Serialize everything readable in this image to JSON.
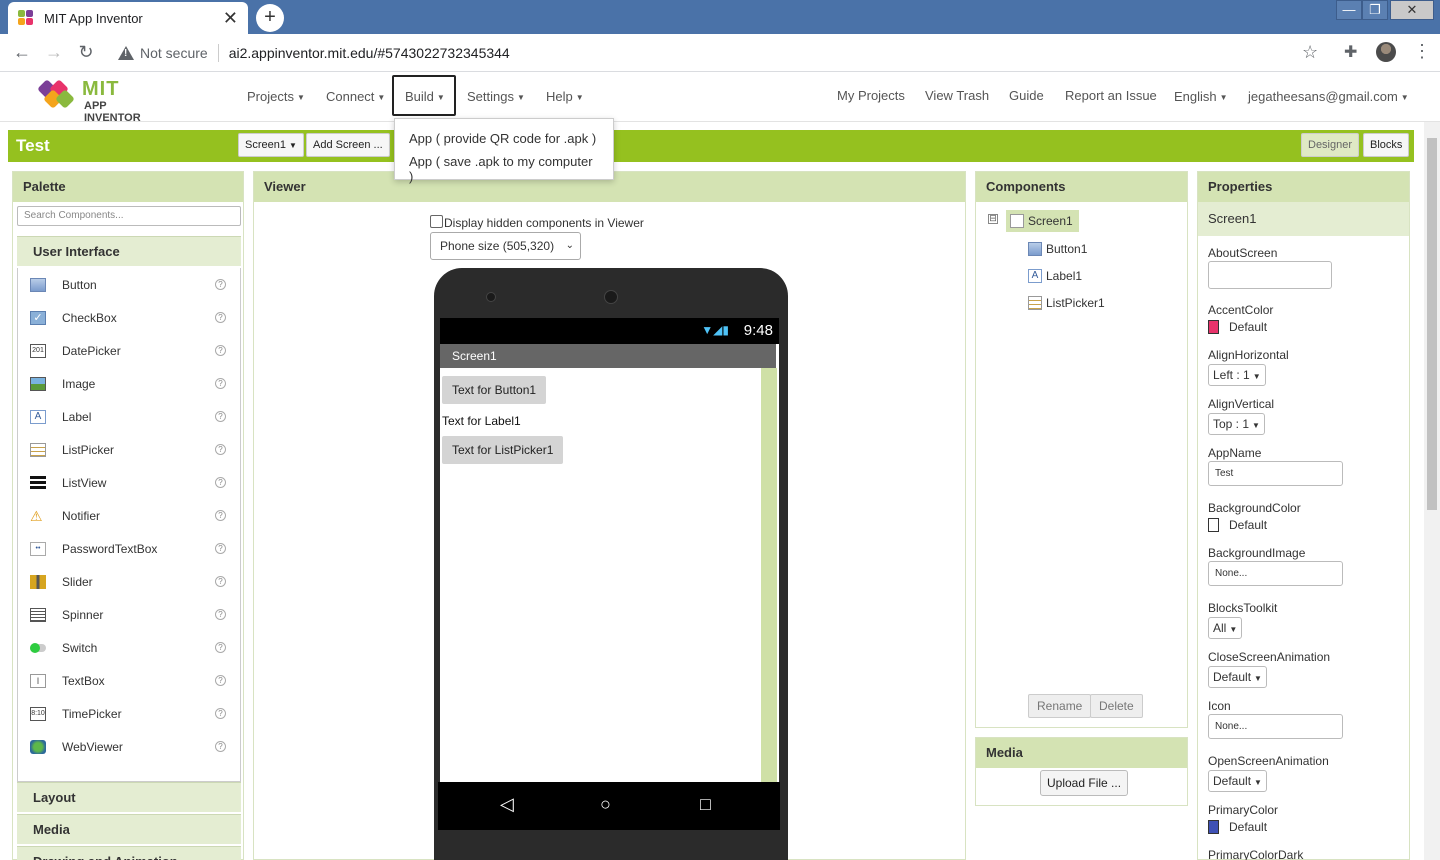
{
  "browser": {
    "tab_title": "MIT App Inventor",
    "tab_close": "✕",
    "new_tab": "+",
    "not_secure": "Not secure",
    "url": "ai2.appinventor.mit.edu/#5743022732345344",
    "window_controls": [
      "—",
      "❐",
      "✕"
    ]
  },
  "header": {
    "logo_mit": "MIT",
    "logo_sub": "APP INVENTOR",
    "left_menu": [
      "Projects",
      "Connect",
      "Build",
      "Settings",
      "Help"
    ],
    "right_links": [
      "My Projects",
      "View Trash",
      "Guide",
      "Report an Issue"
    ],
    "language": "English",
    "account": "jegatheesans@gmail.com"
  },
  "build_menu": {
    "items": [
      "App ( provide QR code for .apk )",
      "App ( save .apk to my computer )"
    ]
  },
  "project": {
    "title": "Test",
    "screen_select": "Screen1",
    "add_screen": "Add Screen ...",
    "designer": "Designer",
    "blocks": "Blocks"
  },
  "palette": {
    "title": "Palette",
    "search_placeholder": "Search Components...",
    "category_open": "User Interface",
    "items": [
      "Button",
      "CheckBox",
      "DatePicker",
      "Image",
      "Label",
      "ListPicker",
      "ListView",
      "Notifier",
      "PasswordTextBox",
      "Slider",
      "Spinner",
      "Switch",
      "TextBox",
      "TimePicker",
      "WebViewer"
    ],
    "help_glyph": "?",
    "categories_closed": [
      "Layout",
      "Media",
      "Drawing and Animation"
    ]
  },
  "viewer": {
    "title": "Viewer",
    "hidden_label": "Display hidden components in Viewer",
    "size_select": "Phone size (505,320)",
    "phone": {
      "time": "9:48",
      "signal": "▼◢▮",
      "screen_title": "Screen1",
      "button_text": "Text for Button1",
      "label_text": "Text for Label1",
      "listpicker_text": "Text for ListPicker1",
      "nav": [
        "◁",
        "○",
        "□"
      ]
    }
  },
  "components": {
    "title": "Components",
    "toggle": "⊟",
    "tree": [
      "Screen1",
      "Button1",
      "Label1",
      "ListPicker1"
    ],
    "rename": "Rename",
    "delete": "Delete"
  },
  "media": {
    "title": "Media",
    "upload": "Upload File ..."
  },
  "properties": {
    "title": "Properties",
    "subject": "Screen1",
    "about_screen_label": "AboutScreen",
    "accent_label": "AccentColor",
    "accent_value": "Default",
    "accent_color": "#e8336b",
    "align_h_label": "AlignHorizontal",
    "align_h_value": "Left : 1",
    "align_v_label": "AlignVertical",
    "align_v_value": "Top : 1",
    "appname_label": "AppName",
    "appname_value": "Test",
    "bgcolor_label": "BackgroundColor",
    "bgcolor_value": "Default",
    "bgcolor_color": "#ffffff",
    "bgimage_label": "BackgroundImage",
    "bgimage_value": "None...",
    "blocks_toolkit_label": "BlocksToolkit",
    "blocks_toolkit_value": "All",
    "close_anim_label": "CloseScreenAnimation",
    "close_anim_value": "Default",
    "icon_label": "Icon",
    "icon_value": "None...",
    "open_anim_label": "OpenScreenAnimation",
    "open_anim_value": "Default",
    "primary_label": "PrimaryColor",
    "primary_value": "Default",
    "primary_color": "#3f51b5",
    "primary_dark_label": "PrimaryColorDark"
  },
  "colors": {
    "brand_green": "#95c11f",
    "panel_header": "#d4e3b3",
    "browser_tabstrip": "#4a72a8"
  }
}
